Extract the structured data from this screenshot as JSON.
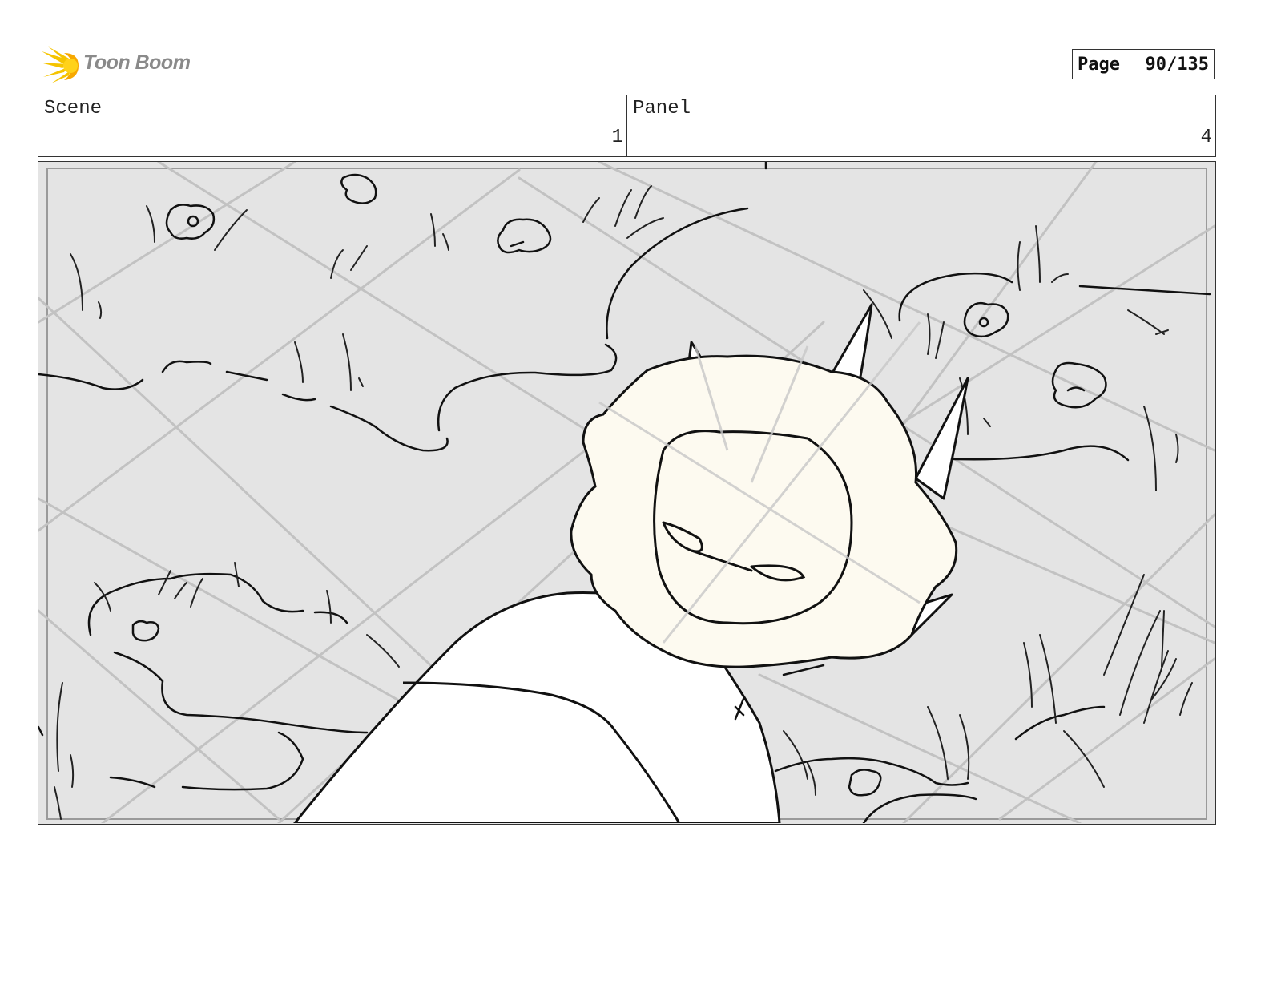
{
  "header": {
    "logo_text": "Toon Boom",
    "page_label": "Page",
    "page_value": "90/135"
  },
  "info": {
    "scene_label": "Scene",
    "scene_value": "1",
    "panel_label": "Panel",
    "panel_value": "4"
  },
  "colors": {
    "logo_yellow": "#f5c400",
    "ground_gray": "#e4e4e4",
    "tile_lines": "#c4c4c4",
    "head_fill": "#fdfaf0"
  }
}
